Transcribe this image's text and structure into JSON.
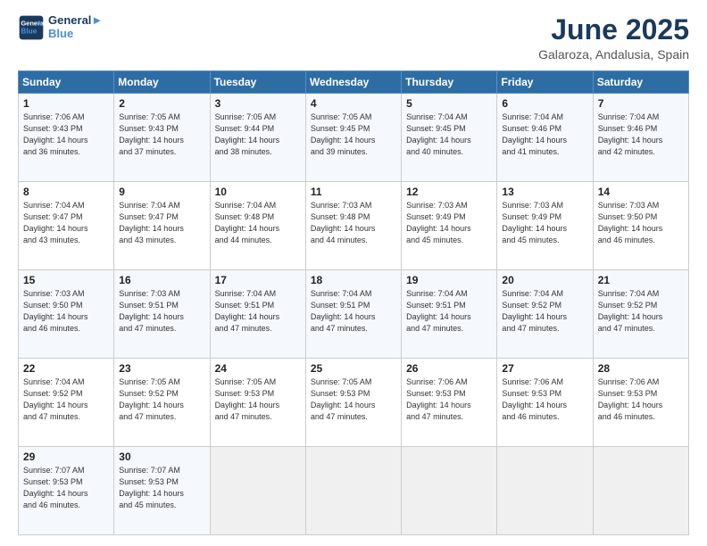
{
  "logo": {
    "line1": "General",
    "line2": "Blue"
  },
  "title": "June 2025",
  "subtitle": "Galaroza, Andalusia, Spain",
  "header_days": [
    "Sunday",
    "Monday",
    "Tuesday",
    "Wednesday",
    "Thursday",
    "Friday",
    "Saturday"
  ],
  "weeks": [
    [
      {
        "day": "1",
        "info": "Sunrise: 7:06 AM\nSunset: 9:43 PM\nDaylight: 14 hours\nand 36 minutes."
      },
      {
        "day": "2",
        "info": "Sunrise: 7:05 AM\nSunset: 9:43 PM\nDaylight: 14 hours\nand 37 minutes."
      },
      {
        "day": "3",
        "info": "Sunrise: 7:05 AM\nSunset: 9:44 PM\nDaylight: 14 hours\nand 38 minutes."
      },
      {
        "day": "4",
        "info": "Sunrise: 7:05 AM\nSunset: 9:45 PM\nDaylight: 14 hours\nand 39 minutes."
      },
      {
        "day": "5",
        "info": "Sunrise: 7:04 AM\nSunset: 9:45 PM\nDaylight: 14 hours\nand 40 minutes."
      },
      {
        "day": "6",
        "info": "Sunrise: 7:04 AM\nSunset: 9:46 PM\nDaylight: 14 hours\nand 41 minutes."
      },
      {
        "day": "7",
        "info": "Sunrise: 7:04 AM\nSunset: 9:46 PM\nDaylight: 14 hours\nand 42 minutes."
      }
    ],
    [
      {
        "day": "8",
        "info": "Sunrise: 7:04 AM\nSunset: 9:47 PM\nDaylight: 14 hours\nand 43 minutes."
      },
      {
        "day": "9",
        "info": "Sunrise: 7:04 AM\nSunset: 9:47 PM\nDaylight: 14 hours\nand 43 minutes."
      },
      {
        "day": "10",
        "info": "Sunrise: 7:04 AM\nSunset: 9:48 PM\nDaylight: 14 hours\nand 44 minutes."
      },
      {
        "day": "11",
        "info": "Sunrise: 7:03 AM\nSunset: 9:48 PM\nDaylight: 14 hours\nand 44 minutes."
      },
      {
        "day": "12",
        "info": "Sunrise: 7:03 AM\nSunset: 9:49 PM\nDaylight: 14 hours\nand 45 minutes."
      },
      {
        "day": "13",
        "info": "Sunrise: 7:03 AM\nSunset: 9:49 PM\nDaylight: 14 hours\nand 45 minutes."
      },
      {
        "day": "14",
        "info": "Sunrise: 7:03 AM\nSunset: 9:50 PM\nDaylight: 14 hours\nand 46 minutes."
      }
    ],
    [
      {
        "day": "15",
        "info": "Sunrise: 7:03 AM\nSunset: 9:50 PM\nDaylight: 14 hours\nand 46 minutes."
      },
      {
        "day": "16",
        "info": "Sunrise: 7:03 AM\nSunset: 9:51 PM\nDaylight: 14 hours\nand 47 minutes."
      },
      {
        "day": "17",
        "info": "Sunrise: 7:04 AM\nSunset: 9:51 PM\nDaylight: 14 hours\nand 47 minutes."
      },
      {
        "day": "18",
        "info": "Sunrise: 7:04 AM\nSunset: 9:51 PM\nDaylight: 14 hours\nand 47 minutes."
      },
      {
        "day": "19",
        "info": "Sunrise: 7:04 AM\nSunset: 9:51 PM\nDaylight: 14 hours\nand 47 minutes."
      },
      {
        "day": "20",
        "info": "Sunrise: 7:04 AM\nSunset: 9:52 PM\nDaylight: 14 hours\nand 47 minutes."
      },
      {
        "day": "21",
        "info": "Sunrise: 7:04 AM\nSunset: 9:52 PM\nDaylight: 14 hours\nand 47 minutes."
      }
    ],
    [
      {
        "day": "22",
        "info": "Sunrise: 7:04 AM\nSunset: 9:52 PM\nDaylight: 14 hours\nand 47 minutes."
      },
      {
        "day": "23",
        "info": "Sunrise: 7:05 AM\nSunset: 9:52 PM\nDaylight: 14 hours\nand 47 minutes."
      },
      {
        "day": "24",
        "info": "Sunrise: 7:05 AM\nSunset: 9:53 PM\nDaylight: 14 hours\nand 47 minutes."
      },
      {
        "day": "25",
        "info": "Sunrise: 7:05 AM\nSunset: 9:53 PM\nDaylight: 14 hours\nand 47 minutes."
      },
      {
        "day": "26",
        "info": "Sunrise: 7:06 AM\nSunset: 9:53 PM\nDaylight: 14 hours\nand 47 minutes."
      },
      {
        "day": "27",
        "info": "Sunrise: 7:06 AM\nSunset: 9:53 PM\nDaylight: 14 hours\nand 46 minutes."
      },
      {
        "day": "28",
        "info": "Sunrise: 7:06 AM\nSunset: 9:53 PM\nDaylight: 14 hours\nand 46 minutes."
      }
    ],
    [
      {
        "day": "29",
        "info": "Sunrise: 7:07 AM\nSunset: 9:53 PM\nDaylight: 14 hours\nand 46 minutes."
      },
      {
        "day": "30",
        "info": "Sunrise: 7:07 AM\nSunset: 9:53 PM\nDaylight: 14 hours\nand 45 minutes."
      },
      {
        "day": "",
        "info": ""
      },
      {
        "day": "",
        "info": ""
      },
      {
        "day": "",
        "info": ""
      },
      {
        "day": "",
        "info": ""
      },
      {
        "day": "",
        "info": ""
      }
    ]
  ]
}
